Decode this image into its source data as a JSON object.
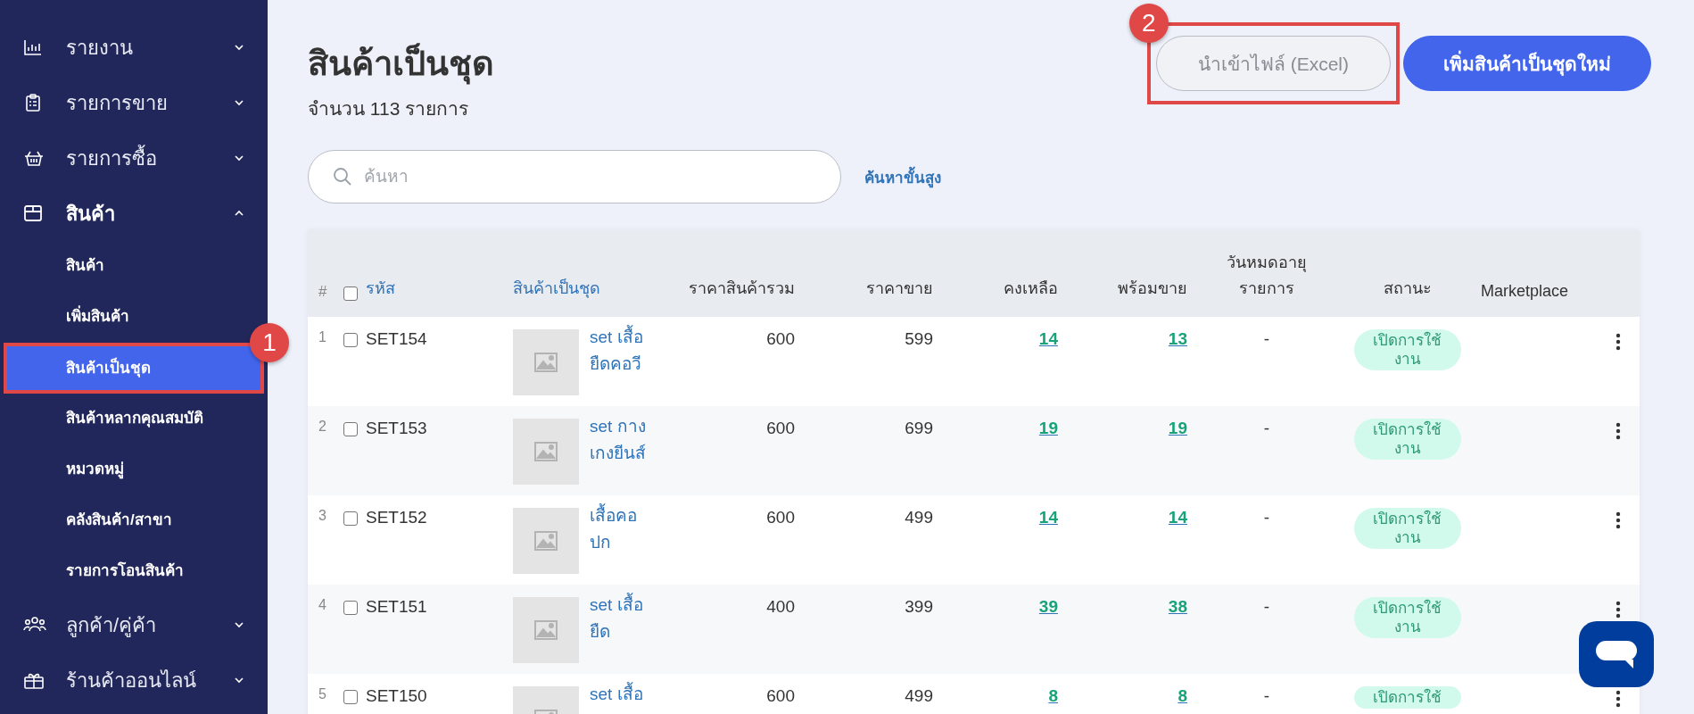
{
  "sidebar": {
    "items": [
      {
        "label": "รายงาน",
        "expanded": false
      },
      {
        "label": "รายการขาย",
        "expanded": false
      },
      {
        "label": "รายการซื้อ",
        "expanded": false
      },
      {
        "label": "สินค้า",
        "expanded": true,
        "children": [
          {
            "label": "สินค้า",
            "selected": false
          },
          {
            "label": "เพิ่มสินค้า",
            "selected": false
          },
          {
            "label": "สินค้าเป็นชุด",
            "selected": true,
            "callout": "1"
          },
          {
            "label": "สินค้าหลากคุณสมบัติ",
            "selected": false
          },
          {
            "label": "หมวดหมู่",
            "selected": false
          },
          {
            "label": "คลังสินค้า/สาขา",
            "selected": false
          },
          {
            "label": "รายการโอนสินค้า",
            "selected": false
          }
        ]
      },
      {
        "label": "ลูกค้า/คู่ค้า",
        "expanded": false
      },
      {
        "label": "ร้านค้าออนไลน์",
        "expanded": false
      }
    ]
  },
  "page": {
    "title": "สินค้าเป็นชุด",
    "count": "จำนวน 113 รายการ"
  },
  "buttons": [
    {
      "label": "นำเข้าไฟล์ (Excel)",
      "kind": "secondary",
      "callout": "2"
    },
    {
      "label": "เพิ่มสินค้าเป็นชุดใหม่",
      "kind": "primary"
    }
  ],
  "search": {
    "placeholder": "ค้นหา",
    "advanced_link": "ค้นหาขั้นสูง"
  },
  "table": {
    "index_header": "#",
    "select_all_checked": false,
    "columns": [
      {
        "label": "รหัส",
        "kind": "link"
      },
      {
        "label": "สินค้าเป็นชุด",
        "kind": "link"
      },
      {
        "label": "ราคาสินค้ารวม",
        "kind": "plain"
      },
      {
        "label": "ราคาขาย",
        "kind": "plain"
      },
      {
        "label": "คงเหลือ",
        "kind": "plain"
      },
      {
        "label": "พร้อมขาย",
        "kind": "plain"
      },
      {
        "label": "วันหมดอายุ\nรายการ",
        "kind": "plain"
      },
      {
        "label": "สถานะ",
        "kind": "plain"
      },
      {
        "label": "Marketplace",
        "kind": "plain"
      }
    ],
    "rows": [
      {
        "index": "1",
        "checked": false,
        "code": "SET154",
        "name": "set เสื้อยืดคอวี",
        "total_price": "600",
        "price": "599",
        "remaining": "14",
        "ready": "13",
        "expiry": "-",
        "status": "เปิดการใช้งาน"
      },
      {
        "index": "2",
        "checked": false,
        "code": "SET153",
        "name": "set กางเกงยีนส์",
        "total_price": "600",
        "price": "699",
        "remaining": "19",
        "ready": "19",
        "expiry": "-",
        "status": "เปิดการใช้งาน"
      },
      {
        "index": "3",
        "checked": false,
        "code": "SET152",
        "name": "เสื้อคอปก",
        "total_price": "600",
        "price": "499",
        "remaining": "14",
        "ready": "14",
        "expiry": "-",
        "status": "เปิดการใช้งาน"
      },
      {
        "index": "4",
        "checked": false,
        "code": "SET151",
        "name": "set เสื้อยืด",
        "total_price": "400",
        "price": "399",
        "remaining": "39",
        "ready": "38",
        "expiry": "-",
        "status": "เปิดการใช้งาน"
      },
      {
        "index": "5",
        "checked": false,
        "code": "SET150",
        "name": "set เสื้อ",
        "total_price": "600",
        "price": "499",
        "remaining": "8",
        "ready": "8",
        "expiry": "-",
        "status": "เปิดการใช้"
      }
    ]
  }
}
